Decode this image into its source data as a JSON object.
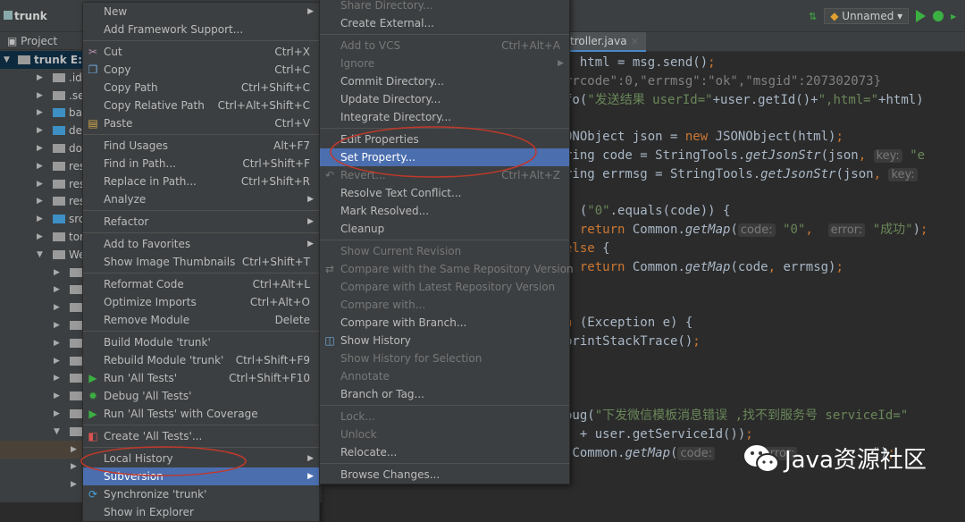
{
  "breadcrumb": "trunk",
  "toolbar": {
    "run_config": "Unnamed"
  },
  "project_panel": {
    "title": "Project",
    "rows": [
      {
        "label": "trunk  E:\\",
        "indent": 0,
        "open": true,
        "bold": true
      },
      {
        "label": ".idea",
        "indent": 1
      },
      {
        "label": ".setting",
        "indent": 1
      },
      {
        "label": "base",
        "indent": 1,
        "blue": true
      },
      {
        "label": "demo",
        "indent": 1,
        "blue": true
      },
      {
        "label": "doc",
        "indent": 1
      },
      {
        "label": "resour",
        "indent": 1
      },
      {
        "label": "resour",
        "indent": 1
      },
      {
        "label": "resour",
        "indent": 1
      },
      {
        "label": "src",
        "indent": 1,
        "blue": true
      },
      {
        "label": "tomcat",
        "indent": 1
      },
      {
        "label": "WebR",
        "indent": 1,
        "open": true
      },
      {
        "label": "css",
        "indent": 2
      },
      {
        "label": "ima",
        "indent": 2
      },
      {
        "label": "inc",
        "indent": 2
      },
      {
        "label": "js",
        "indent": 2
      },
      {
        "label": "ME",
        "indent": 2
      },
      {
        "label": "mp",
        "indent": 2
      },
      {
        "label": "mp",
        "indent": 2
      },
      {
        "label": "sty",
        "indent": 2
      },
      {
        "label": "we",
        "indent": 2
      },
      {
        "label": "WE",
        "indent": 2,
        "open": true
      },
      {
        "label": "",
        "indent": 3,
        "orange": true
      },
      {
        "label": "",
        "indent": 3
      },
      {
        "label": "",
        "indent": 3
      }
    ]
  },
  "context_menu": [
    {
      "label": "New",
      "sub": true
    },
    {
      "label": "Add Framework Support..."
    },
    {
      "sep": true
    },
    {
      "label": "Cut",
      "sc": "Ctrl+X",
      "icon": "scissors"
    },
    {
      "label": "Copy",
      "sc": "Ctrl+C",
      "icon": "copy"
    },
    {
      "label": "Copy Path",
      "sc": "Ctrl+Shift+C"
    },
    {
      "label": "Copy Relative Path",
      "sc": "Ctrl+Alt+Shift+C"
    },
    {
      "label": "Paste",
      "sc": "Ctrl+V",
      "icon": "paste"
    },
    {
      "sep": true
    },
    {
      "label": "Find Usages",
      "sc": "Alt+F7"
    },
    {
      "label": "Find in Path...",
      "sc": "Ctrl+Shift+F"
    },
    {
      "label": "Replace in Path...",
      "sc": "Ctrl+Shift+R"
    },
    {
      "label": "Analyze",
      "sub": true
    },
    {
      "sep": true
    },
    {
      "label": "Refactor",
      "sub": true
    },
    {
      "sep": true
    },
    {
      "label": "Add to Favorites",
      "sub": true
    },
    {
      "label": "Show Image Thumbnails",
      "sc": "Ctrl+Shift+T"
    },
    {
      "sep": true
    },
    {
      "label": "Reformat Code",
      "sc": "Ctrl+Alt+L"
    },
    {
      "label": "Optimize Imports",
      "sc": "Ctrl+Alt+O"
    },
    {
      "label": "Remove Module",
      "sc": "Delete"
    },
    {
      "sep": true
    },
    {
      "label": "Build Module 'trunk'"
    },
    {
      "label": "Rebuild Module 'trunk'",
      "sc": "Ctrl+Shift+F9"
    },
    {
      "label": "Run 'All Tests'",
      "sc": "Ctrl+Shift+F10",
      "icon": "run"
    },
    {
      "label": "Debug 'All Tests'",
      "icon": "debug"
    },
    {
      "label": "Run 'All Tests' with Coverage",
      "icon": "coverage"
    },
    {
      "sep": true
    },
    {
      "label": "Create 'All Tests'...",
      "icon": "create-test"
    },
    {
      "sep": true
    },
    {
      "label": "Local History",
      "sub": true
    },
    {
      "label": "Subversion",
      "sub": true,
      "hl": true
    },
    {
      "label": "Synchronize 'trunk'",
      "icon": "sync"
    },
    {
      "label": "Show in Explorer"
    }
  ],
  "subversion_menu": [
    {
      "label": "Share Directory...",
      "dis": true
    },
    {
      "label": "Create External..."
    },
    {
      "sep": true
    },
    {
      "label": "Add to VCS",
      "sc": "Ctrl+Alt+A",
      "dis": true
    },
    {
      "label": "Ignore",
      "sub": true,
      "dis": true
    },
    {
      "label": "Commit Directory..."
    },
    {
      "label": "Update Directory..."
    },
    {
      "label": "Integrate Directory..."
    },
    {
      "sep": true
    },
    {
      "label": "Edit Properties"
    },
    {
      "label": "Set Property...",
      "hl": true
    },
    {
      "label": "Revert...",
      "sc": "Ctrl+Alt+Z",
      "dis": true,
      "icon": "revert"
    },
    {
      "label": "Resolve Text Conflict..."
    },
    {
      "label": "Mark Resolved..."
    },
    {
      "label": "Cleanup"
    },
    {
      "sep": true
    },
    {
      "label": "Show Current Revision",
      "dis": true
    },
    {
      "label": "Compare with the Same Repository Version",
      "dis": true,
      "icon": "compare"
    },
    {
      "label": "Compare with Latest Repository Version",
      "dis": true
    },
    {
      "label": "Compare with...",
      "dis": true
    },
    {
      "label": "Compare with Branch..."
    },
    {
      "label": "Show History",
      "icon": "history"
    },
    {
      "label": "Show History for Selection",
      "dis": true
    },
    {
      "label": "Annotate",
      "dis": true
    },
    {
      "label": "Branch or Tag..."
    },
    {
      "sep": true
    },
    {
      "label": "Lock...",
      "dis": true
    },
    {
      "label": "Unlock",
      "dis": true
    },
    {
      "label": "Relocate..."
    },
    {
      "sep": true
    },
    {
      "label": "Browse Changes..."
    }
  ],
  "editor": {
    "tab": "troller.java",
    "lines": [
      [
        [
          "  html = msg.send()",
          ""
        ],
        [
          ";",
          "kw"
        ]
      ],
      [
        [
          "rrcode\":0,\"errmsg\":\"ok\",\"msgid\":207302073}",
          "cm"
        ]
      ],
      [
        [
          "fo(",
          ""
        ],
        [
          "\"发送结果 userId=\"",
          "str"
        ],
        [
          "+user.getId()+",
          ""
        ],
        [
          "\",html=\"",
          "str"
        ],
        [
          "+html)",
          ""
        ]
      ],
      [],
      [
        [
          "ONObject json = ",
          ""
        ],
        [
          "new",
          "kw"
        ],
        [
          " JSONObject(html)",
          ""
        ],
        [
          ";",
          "kw"
        ]
      ],
      [
        [
          "ring code = StringTools.",
          ""
        ],
        [
          "getJsonStr",
          "it"
        ],
        [
          "(json",
          ""
        ],
        [
          ", ",
          "kw"
        ],
        [
          "key:",
          "hint"
        ],
        [
          " \"e",
          "str"
        ]
      ],
      [
        [
          "ring errmsg = StringTools.",
          ""
        ],
        [
          "getJsonStr",
          "it"
        ],
        [
          "(json",
          ""
        ],
        [
          ", ",
          "kw"
        ],
        [
          "key:",
          "hint"
        ]
      ],
      [],
      [
        [
          "  (",
          ""
        ],
        [
          "\"0\"",
          "str"
        ],
        [
          ".equals(code)) {",
          ""
        ]
      ],
      [
        [
          "  ",
          ""
        ],
        [
          "return",
          "kw"
        ],
        [
          " Common.",
          ""
        ],
        [
          "getMap",
          "it"
        ],
        [
          "(",
          ""
        ],
        [
          "code:",
          "hint"
        ],
        [
          " ",
          ""
        ],
        [
          "\"0\"",
          "str"
        ],
        [
          ",  ",
          "kw"
        ],
        [
          "error:",
          "hint"
        ],
        [
          " ",
          ""
        ],
        [
          "\"成功\"",
          "str"
        ],
        [
          ")",
          ""
        ],
        [
          ";",
          "kw"
        ]
      ],
      [
        [
          "else",
          "kw"
        ],
        [
          " {",
          ""
        ]
      ],
      [
        [
          "  ",
          ""
        ],
        [
          "return",
          "kw"
        ],
        [
          " Common.",
          ""
        ],
        [
          "getMap",
          "it"
        ],
        [
          "(code",
          ""
        ],
        [
          ",",
          "kw"
        ],
        [
          " errmsg)",
          ""
        ],
        [
          ";",
          "kw"
        ]
      ],
      [],
      [],
      [
        [
          "n",
          "kw"
        ],
        [
          " (Exception e) {",
          ""
        ]
      ],
      [
        [
          "printStackTrace()",
          ""
        ],
        [
          ";",
          "kw"
        ]
      ],
      [],
      [],
      [],
      [
        [
          "oug(",
          ""
        ],
        [
          "\"下发微信模板消息错误 ,找不到服务号 serviceId=\"",
          "str"
        ]
      ],
      [
        [
          "  + user.getServiceId())",
          ""
        ],
        [
          ";",
          "kw"
        ]
      ],
      [
        [
          " Common.",
          ""
        ],
        [
          "getMap",
          "it"
        ],
        [
          "(",
          ""
        ],
        [
          "code:",
          "hint"
        ],
        [
          "      ",
          ""
        ],
        [
          "error:",
          "hint"
        ],
        [
          "          \")",
          ""
        ],
        [
          ";",
          "kw"
        ]
      ]
    ]
  },
  "watermark": "Java资源社区",
  "colors": {
    "menu_bg": "#3c3f41",
    "highlight": "#4b6eaf",
    "editor_bg": "#2b2b2b",
    "annotation": "#c0392b"
  }
}
